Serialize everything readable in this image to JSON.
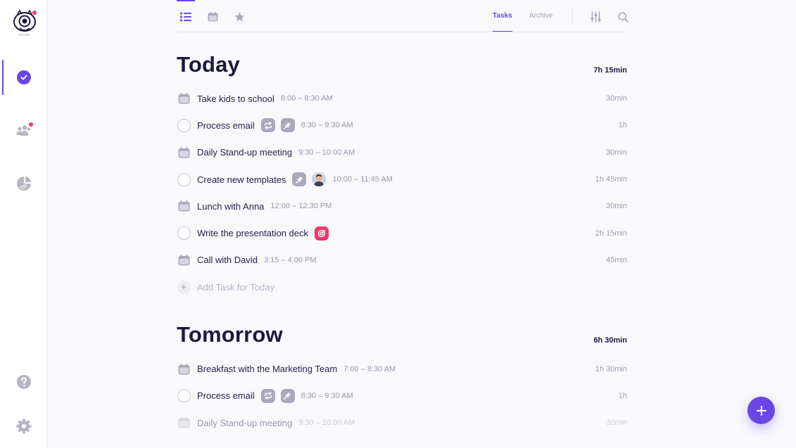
{
  "colors": {
    "accent": "#6a46e5",
    "badge": "#f0386b",
    "chip": "#a9a8bc",
    "text": "#1c1940",
    "muted": "#9796ab"
  },
  "sidebar": {
    "logo": "owl-logo-icon",
    "items": [
      {
        "icon": "check-circle-icon",
        "active": true
      },
      {
        "icon": "team-icon",
        "badge": true
      },
      {
        "icon": "pie-chart-icon"
      }
    ],
    "bottom": [
      {
        "icon": "help-icon"
      },
      {
        "icon": "settings-icon"
      }
    ]
  },
  "topbar": {
    "views": [
      "list-view-icon",
      "calendar-view-icon",
      "star-view-icon"
    ],
    "tabs": [
      {
        "label": "Tasks",
        "active": true
      },
      {
        "label": "Archive",
        "active": false
      }
    ],
    "actions": [
      "filter-sliders-icon",
      "search-icon"
    ]
  },
  "today": {
    "title": "Today",
    "total": "7h 15min",
    "tasks": [
      {
        "type": "event",
        "title": "Take kids to school",
        "time": "8:00 – 8:30 AM",
        "duration": "30min"
      },
      {
        "type": "task",
        "title": "Process email",
        "tags": [
          "repeat-icon",
          "pin-icon"
        ],
        "time": "8:30 – 9:30 AM",
        "duration": "1h"
      },
      {
        "type": "event",
        "title": "Daily Stand-up meeting",
        "time": "9:30 – 10:00 AM",
        "duration": "30min"
      },
      {
        "type": "task",
        "title": "Create new templates",
        "tags": [
          "pin-icon",
          "avatar"
        ],
        "time": "10:00 – 11:45 AM",
        "duration": "1h 45min"
      },
      {
        "type": "event",
        "title": "Lunch with Anna",
        "time": "12:00 – 12:30 PM",
        "duration": "30min"
      },
      {
        "type": "task",
        "title": "Write the presentation deck",
        "tags": [
          "target-icon"
        ],
        "time": "",
        "duration": "2h 15min"
      },
      {
        "type": "event",
        "title": "Call with David",
        "time": "3:15 – 4:00 PM",
        "duration": "45min"
      }
    ],
    "add_label": "Add Task for Today"
  },
  "tomorrow": {
    "title": "Tomorrow",
    "total": "6h 30min",
    "tasks": [
      {
        "type": "event",
        "title": "Breakfast with the Marketing Team",
        "time": "7:00 – 8:30 AM",
        "duration": "1h 30min"
      },
      {
        "type": "task",
        "title": "Process email",
        "tags": [
          "repeat-icon",
          "pin-icon"
        ],
        "time": "8:30 – 9:30 AM",
        "duration": "1h"
      },
      {
        "type": "event",
        "title": "Daily Stand-up meeting",
        "time": "9:30 – 10:00 AM",
        "duration": "30min"
      }
    ]
  },
  "fab": {
    "icon": "plus-icon"
  }
}
